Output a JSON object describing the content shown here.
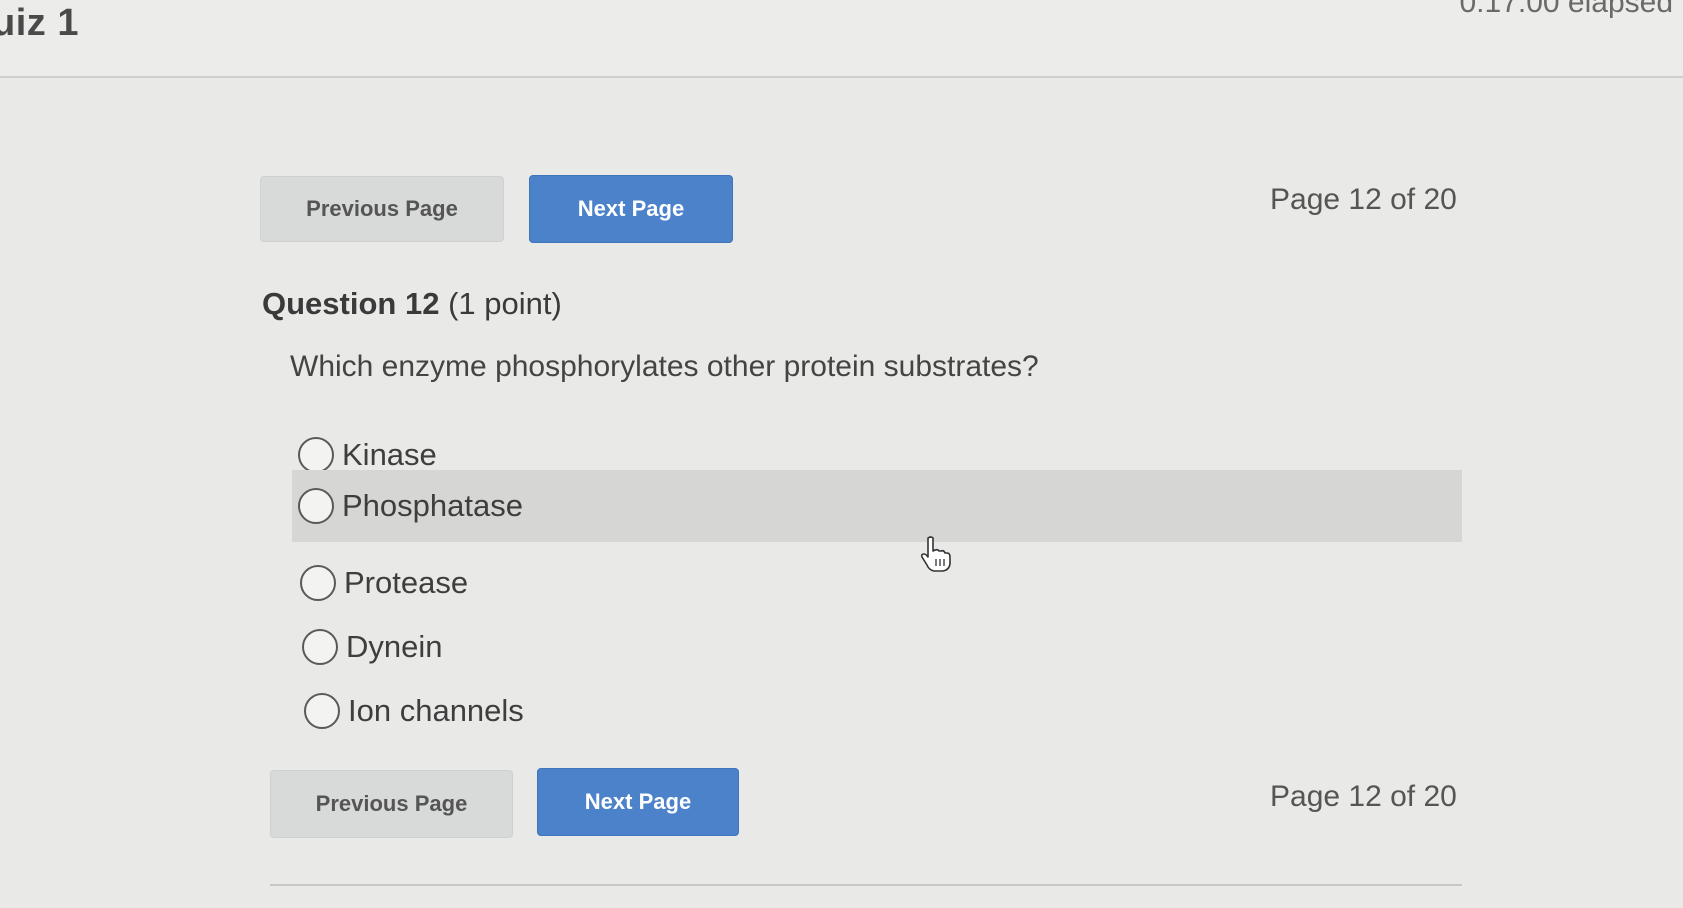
{
  "header": {
    "title": "uiz 1",
    "timer": "0:17:00 elapsed"
  },
  "nav_top": {
    "previous_label": "Previous Page",
    "next_label": "Next Page",
    "page_indicator": "Page 12 of 20"
  },
  "question": {
    "number_label": "Question 12",
    "points_label": "(1 point)",
    "text": "Which enzyme phosphorylates other protein substrates?",
    "options": [
      {
        "label": "Kinase",
        "selected": false
      },
      {
        "label": "Phosphatase",
        "selected": false,
        "hovered": true
      },
      {
        "label": "Protease",
        "selected": false
      },
      {
        "label": "Dynein",
        "selected": false
      },
      {
        "label": "Ion channels",
        "selected": false
      }
    ]
  },
  "nav_bottom": {
    "previous_label": "Previous Page",
    "next_label": "Next Page",
    "page_indicator": "Page 12 of 20"
  },
  "colors": {
    "next_button": "#4b82c9",
    "previous_button": "#d8d9d9",
    "background": "#e9e9e7",
    "hover_row": "#d6d6d4"
  },
  "icons": {
    "cursor": "hand-pointer-icon"
  }
}
